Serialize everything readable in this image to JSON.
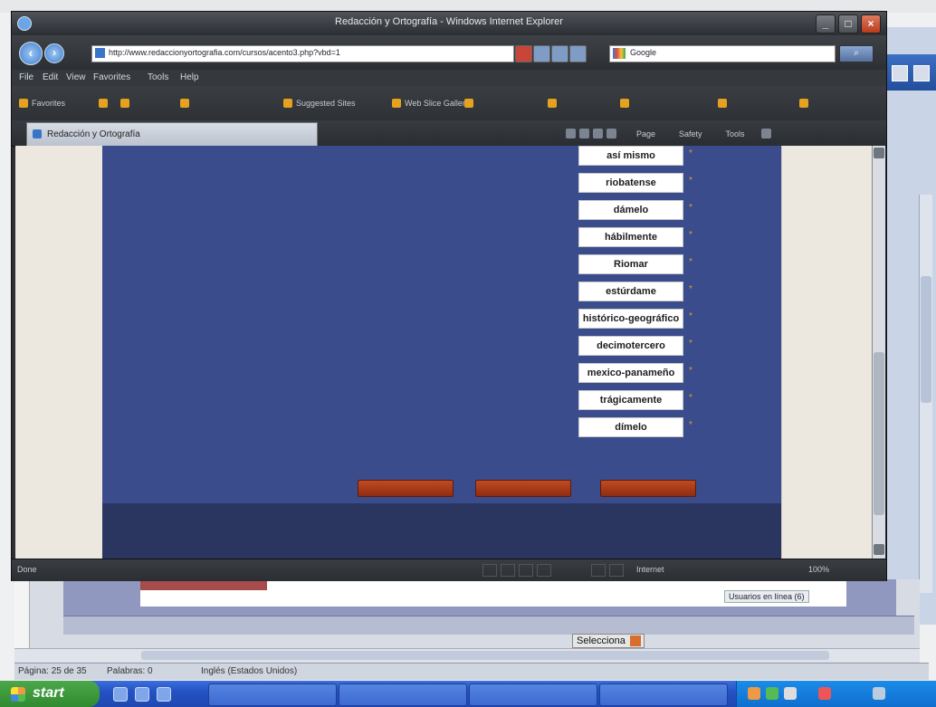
{
  "ie": {
    "title": "Redacción y Ortografía - Windows Internet Explorer",
    "address": "http://www.redaccionyortografia.com/cursos/acento3.php?vbd=1",
    "search": "Google",
    "search_go": "",
    "menu": [
      "File",
      "Edit",
      "View",
      "Favorites",
      "Tools",
      "Help"
    ],
    "favorites": [
      "Favorites",
      "",
      "",
      "",
      "Suggested Sites",
      "Web Slice Gallery",
      "",
      "",
      "",
      "",
      ""
    ],
    "tab_title": "Redacción y Ortografía",
    "commands": [
      "Page",
      "Safety",
      "Tools"
    ],
    "status": "Done",
    "zone": "Internet",
    "zoom": "100%"
  },
  "exercise": {
    "items": [
      {
        "label": "",
        "answer": "así mismo"
      },
      {
        "label": "",
        "answer": "riobatense"
      },
      {
        "label": "",
        "answer": "dámelo"
      },
      {
        "label": "",
        "answer": "hábilmente"
      },
      {
        "label": "",
        "answer": "Riomar"
      },
      {
        "label": "",
        "answer": "estúrdame"
      },
      {
        "label": "",
        "answer": "histórico-geográfico"
      },
      {
        "label": "",
        "answer": "decimotercero"
      },
      {
        "label": "",
        "answer": "mexico-panameño"
      },
      {
        "label": "",
        "answer": "trágicamente"
      },
      {
        "label": "",
        "answer": "dímelo"
      }
    ],
    "result_text": "",
    "result_highlight": "",
    "buttons": [
      "",
      "",
      ""
    ],
    "footer": [
      "",
      "",
      ""
    ]
  },
  "background": {
    "word_line": "",
    "online_label": "Usuarios en línea (6)",
    "select_label": "Selecciona",
    "status_items": [
      "Página: 25 de 35",
      "Palabras: 0",
      "Inglés (Estados Unidos)"
    ]
  },
  "taskbar": {
    "start": "start",
    "tasks": [
      "",
      "",
      "",
      "",
      ""
    ]
  }
}
